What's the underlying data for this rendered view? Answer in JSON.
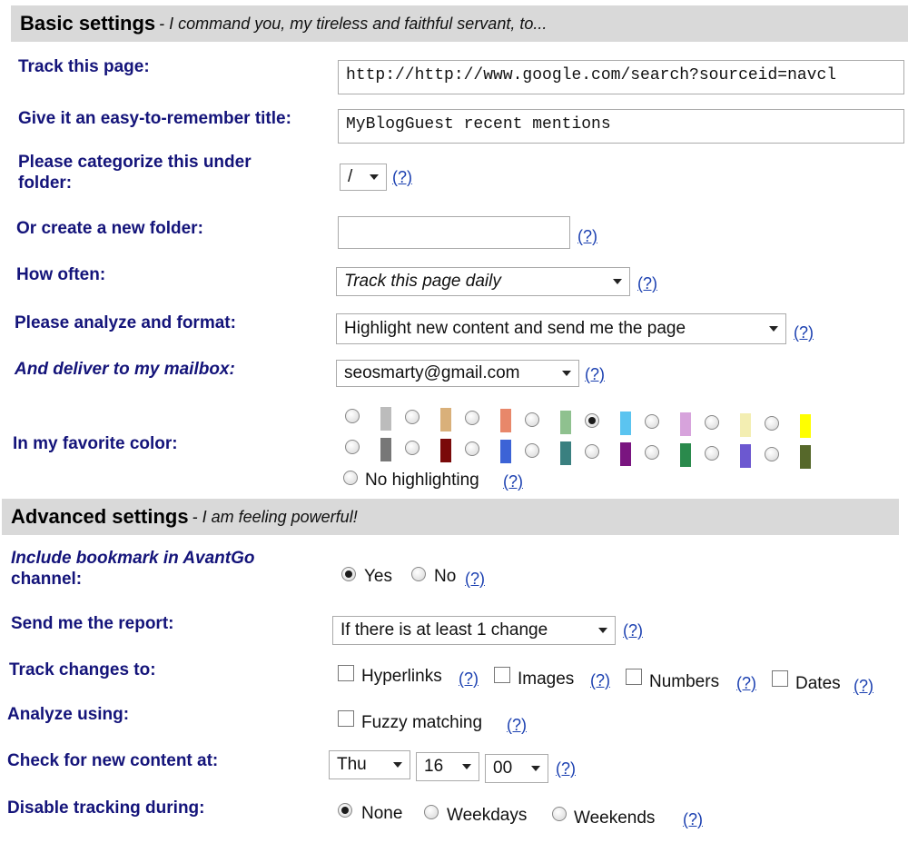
{
  "basic": {
    "title": "Basic settings",
    "subtitle": "- I command you, my tireless and faithful servant, to...",
    "track_page_label": "Track this page:",
    "track_page_value": "http://http://www.google.com/search?sourceid=navcl",
    "title_label": "Give it an easy-to-remember title:",
    "title_value": "MyBlogGuest recent mentions",
    "folder_label_1": "Please categorize this under",
    "folder_label_2": "folder:",
    "folder_value": "/",
    "new_folder_label": "Or create a new folder:",
    "new_folder_value": "",
    "how_often_label": "How often:",
    "how_often_value": "Track this page daily",
    "analyze_label": "Please analyze and format:",
    "analyze_value": "Highlight new content and send me the page",
    "mailbox_label": "And deliver to my mailbox:",
    "mailbox_value": "seosmarty@gmail.com",
    "color_label": "In my favorite color:",
    "no_highlight_label": "No highlighting",
    "help": "(?)"
  },
  "colors": {
    "row1": [
      "#bcbcbc",
      "#d9b07a",
      "#e8876a",
      "#8fc18f",
      "#5bc4f0",
      "#d7a3dc",
      "#f3eeb2",
      "#ffff00"
    ],
    "row2": [
      "#777777",
      "#7a0a0a",
      "#3c63d6",
      "#3a8080",
      "#7a1580",
      "#2a8a4c",
      "#6c58d0",
      "#56682a"
    ],
    "selected_row": 1,
    "selected_index": 4
  },
  "advanced": {
    "title": "Advanced settings",
    "subtitle": "- I am feeling powerful!",
    "avantgo_label_1": "Include bookmark in AvantGo",
    "avantgo_label_2": "channel:",
    "yes": "Yes",
    "no": "No",
    "report_label": "Send me the report:",
    "report_value": "If there is at least 1 change",
    "track_changes_label": "Track changes to:",
    "hyperlinks": "Hyperlinks",
    "images": "Images",
    "numbers": "Numbers",
    "dates": "Dates",
    "analyze_using_label": "Analyze using:",
    "fuzzy": "Fuzzy matching",
    "check_label": "Check for new content at:",
    "day_value": "Thu",
    "hour_value": "16",
    "minute_value": "00",
    "disable_label": "Disable tracking during:",
    "none": "None",
    "weekdays": "Weekdays",
    "weekends": "Weekends",
    "help": "(?)"
  }
}
